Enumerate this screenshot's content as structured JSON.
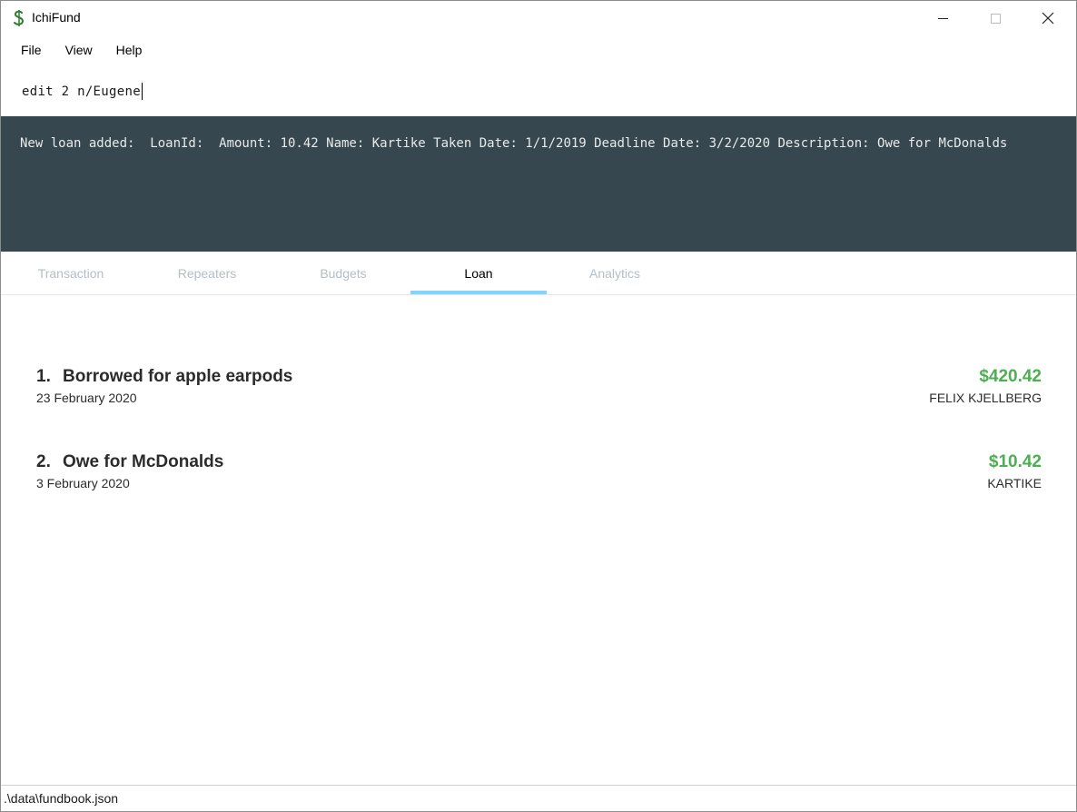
{
  "window": {
    "title": "IchiFund",
    "icon": "dollar-icon"
  },
  "menu": {
    "items": [
      {
        "label": "File"
      },
      {
        "label": "View"
      },
      {
        "label": "Help"
      }
    ]
  },
  "command": {
    "value": "edit 2 n/Eugene"
  },
  "result": {
    "text": "New loan added:  LoanId:  Amount: 10.42 Name: Kartike Taken Date: 1/1/2019 Deadline Date: 3/2/2020 Description: Owe for McDonalds"
  },
  "tabs": {
    "items": [
      {
        "label": "Transaction"
      },
      {
        "label": "Repeaters"
      },
      {
        "label": "Budgets"
      },
      {
        "label": "Loan"
      },
      {
        "label": "Analytics"
      }
    ],
    "active": "Loan"
  },
  "loans": [
    {
      "index": "1.",
      "description": "Borrowed for apple earpods",
      "date": "23 February 2020",
      "amount": "$420.42",
      "name": "FELIX KJELLBERG"
    },
    {
      "index": "2.",
      "description": "Owe for McDonalds",
      "date": "3 February 2020",
      "amount": "$10.42",
      "name": "KARTIKE"
    }
  ],
  "status": {
    "path": ".\\data\\fundbook.json"
  },
  "colors": {
    "result_bg": "#37474f",
    "tab_active_indicator": "#81d4fa",
    "amount_green": "#4caf50",
    "tab_inactive": "#b3bec6"
  }
}
